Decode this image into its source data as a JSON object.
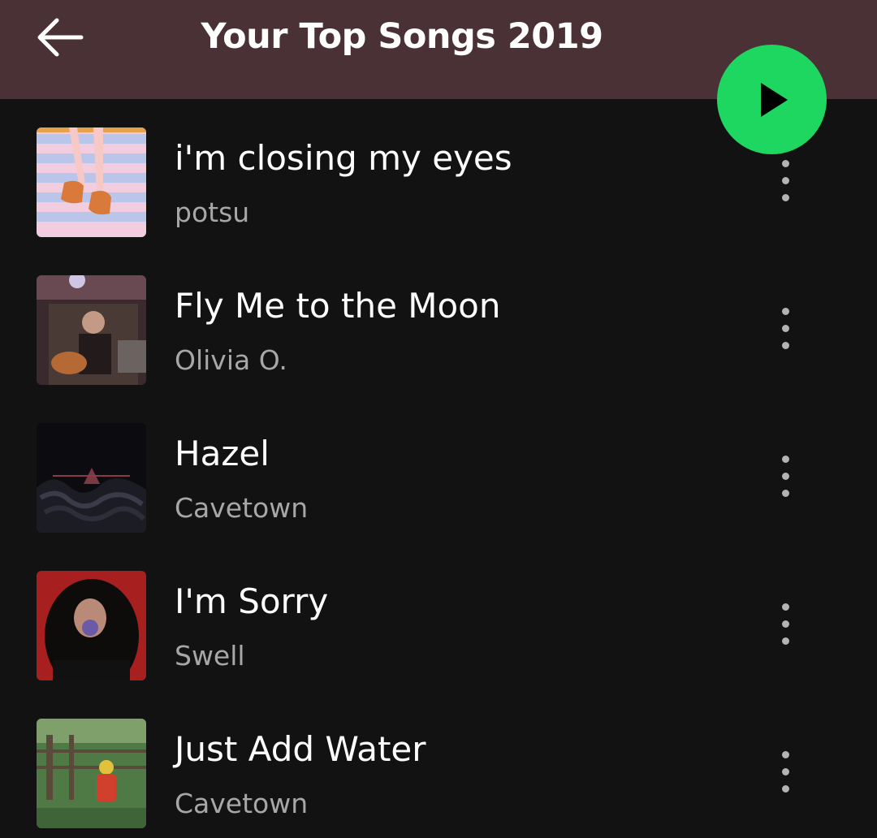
{
  "header": {
    "title": "Your Top Songs 2019",
    "back_icon": "arrow-left-icon",
    "play_icon": "play-icon",
    "background_color": "#4a3135",
    "play_button_color": "#1ed760"
  },
  "songs": [
    {
      "title": "i'm closing my eyes",
      "artist": "potsu",
      "cover": "pink-striped-legs-cover",
      "more_icon": "more-vertical-icon"
    },
    {
      "title": "Fly Me to the Moon",
      "artist": "Olivia O.",
      "cover": "guitar-photo-cover",
      "more_icon": "more-vertical-icon"
    },
    {
      "title": "Hazel",
      "artist": "Cavetown",
      "cover": "cavetown-waves-cover",
      "more_icon": "more-vertical-icon"
    },
    {
      "title": "I'm Sorry",
      "artist": "Swell",
      "cover": "red-portrait-cover",
      "more_icon": "more-vertical-icon"
    },
    {
      "title": "Just Add Water",
      "artist": "Cavetown",
      "cover": "green-field-cover",
      "more_icon": "more-vertical-icon"
    }
  ]
}
